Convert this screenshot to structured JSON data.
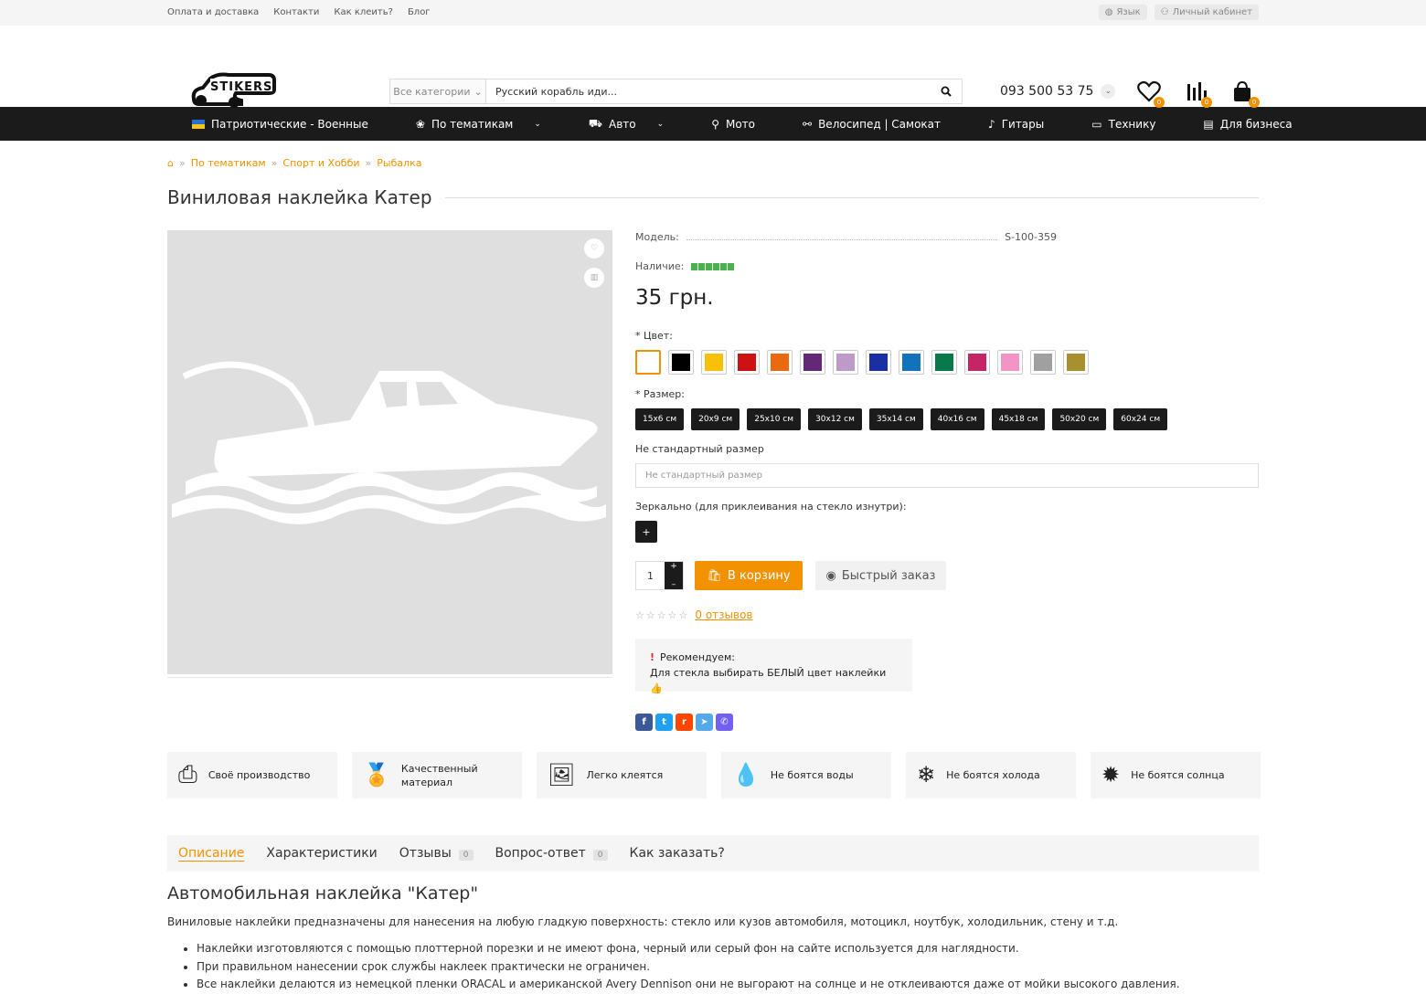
{
  "topbar": {
    "links": [
      "Оплата и доставка",
      "Контакти",
      "Как клеить?",
      "Блог"
    ],
    "language": "Язык",
    "account": "Личный кабинет"
  },
  "header": {
    "logo_text": "STIKERS",
    "search_category": "Все категории",
    "search_value": "Русский корабль иди...",
    "phone": "093 500 53 75",
    "wishlist_count": "0",
    "compare_count": "0",
    "cart_count": "0"
  },
  "nav": {
    "items": [
      "Патриотические - Военные",
      "По тематикам",
      "Авто",
      "Мото",
      "Велосипед | Самокат",
      "Гитары",
      "Технику",
      "Для бизнеса"
    ]
  },
  "breadcrumb": [
    "По тематикам",
    "Спорт и Хобби",
    "Рыбалка"
  ],
  "product": {
    "title": "Виниловая наклейка Катер",
    "model_label": "Модель:",
    "model_value": "S-100-359",
    "availability_label": "Наличие:",
    "availability_level": 6,
    "price": "35 грн.",
    "color_label": "* Цвет:",
    "colors": [
      "#ffffff",
      "#000000",
      "#f7c00b",
      "#cc1212",
      "#ea6a10",
      "#652778",
      "#bd9ac7",
      "#1a2fa2",
      "#1273bd",
      "#07794a",
      "#c52465",
      "#f294c6",
      "#a0a0a0",
      "#a8902e"
    ],
    "size_label": "* Размер:",
    "sizes": [
      "15x6 см",
      "20x9 см",
      "25x10 см",
      "30x12 см",
      "35x14 см",
      "40x16 см",
      "45x18 см",
      "50x20 см",
      "60x24 см"
    ],
    "custom_label": "Не стандартный размер",
    "custom_placeholder": "Не стандартный размер",
    "mirror_label": "Зеркально (для приклеивания на стекло изнутри):",
    "mirror_btn": "+",
    "qty": "1",
    "cart_btn": "В корзину",
    "quick_btn": "Быстрый заказ",
    "reviews_link": "0 отзывов",
    "rec_title": "Рекомендуем:",
    "rec_text": "Для стекла выбирать БЕЛЫЙ цвет наклейки 👍"
  },
  "features": [
    "Своё производство",
    "Качественный материал",
    "Легко клеятся",
    "Не боятся воды",
    "Не боятся холода",
    "Не боятся солнца"
  ],
  "tabs": {
    "t1": "Описание",
    "t2": "Характеристики",
    "t3": "Отзывы",
    "t3c": "0",
    "t4": "Вопрос-ответ",
    "t4c": "0",
    "t5": "Как заказать?"
  },
  "description": {
    "heading": "Автомобильная наклейка \"Катер\"",
    "intro": "Виниловые наклейки предназначены для нанесения на любую гладкую поверхность: стекло или кузов автомобиля, мотоцикл, ноутбук, холодильник, стену и т.д.",
    "bullets": [
      "Наклейки изготовляются с помощью плоттерной порезки и не имеют фона, черный или серый фон на сайте используется для наглядности.",
      "При правильном нанесении срок службы наклеек практически не ограничен.",
      "Все наклейки делаются из немецкой пленки ORACAL и американской Avery Dennison они не выгорают на солнце и не отклеиваются даже от мойки высокого давления."
    ]
  }
}
